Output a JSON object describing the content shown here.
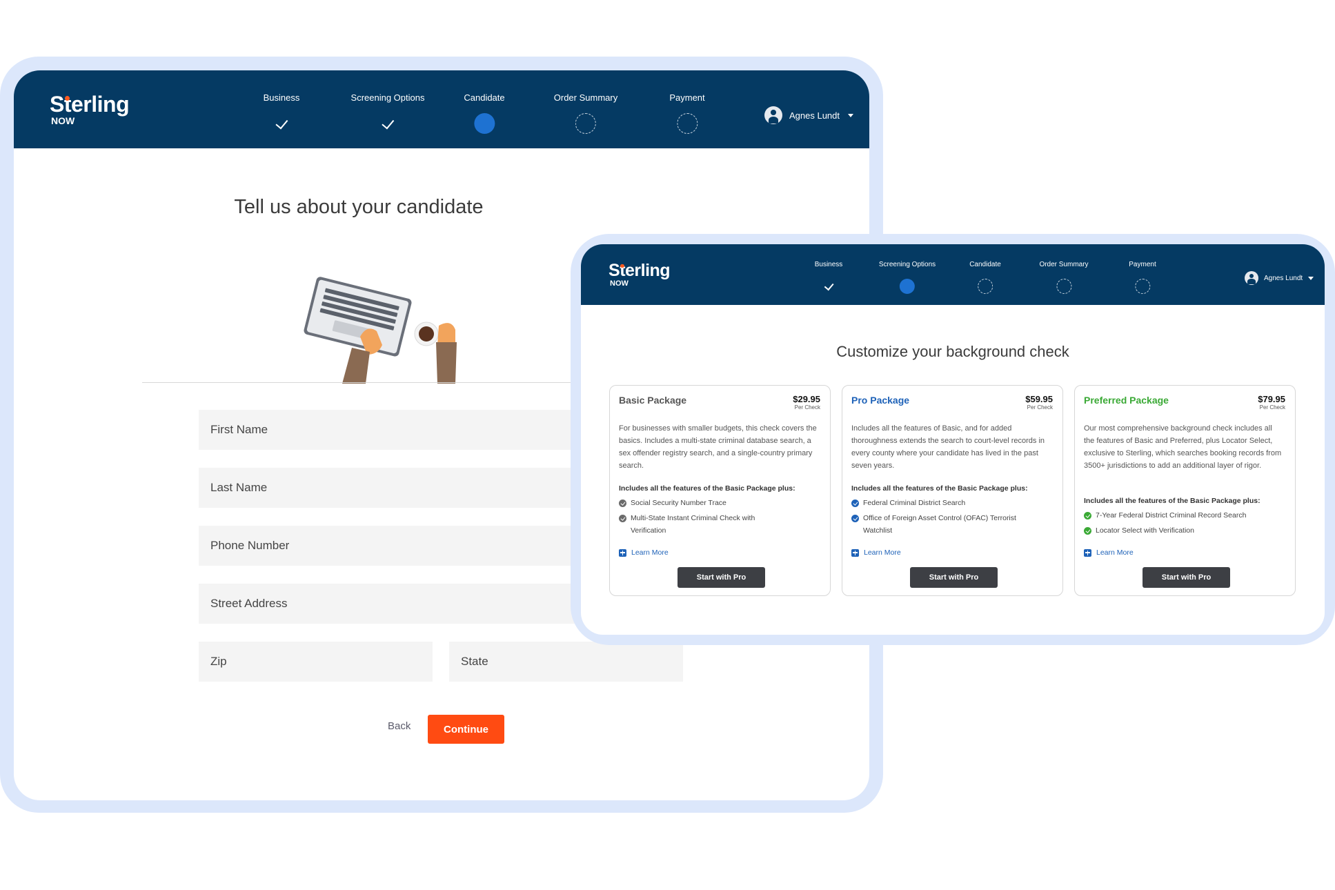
{
  "brand": {
    "word": "Sterling",
    "sub": "NOW",
    "accent": "#ff5a1f",
    "header_bg": "#053a63"
  },
  "window1": {
    "steps": [
      {
        "label": "Business",
        "state": "done"
      },
      {
        "label": "Screening Options",
        "state": "done"
      },
      {
        "label": "Candidate",
        "state": "active"
      },
      {
        "label": "Order Summary",
        "state": "todo"
      },
      {
        "label": "Payment",
        "state": "todo"
      }
    ],
    "user": {
      "name": "Agnes Lundt"
    },
    "title": "Tell us about your candidate",
    "fields": {
      "first_name": "First Name",
      "last_name": "Last Name",
      "phone": "Phone Number",
      "street": "Street Address",
      "zip": "Zip",
      "state": "State"
    },
    "back_label": "Back",
    "continue_label": "Continue",
    "continue_color": "#ff4b12"
  },
  "window2": {
    "steps": [
      {
        "label": "Business",
        "state": "done"
      },
      {
        "label": "Screening Options",
        "state": "active"
      },
      {
        "label": "Candidate",
        "state": "todo"
      },
      {
        "label": "Order Summary",
        "state": "todo"
      },
      {
        "label": "Payment",
        "state": "todo"
      }
    ],
    "user": {
      "name": "Agnes Lundt"
    },
    "title": "Customize your background check",
    "packages": [
      {
        "name": "Basic Package",
        "name_color": "#555555",
        "price": "$29.95",
        "per": "Per Check",
        "description": "For businesses with smaller budgets, this check covers the basics. Includes a multi-state criminal database search, a sex offender registry search, and a single-country primary search.",
        "includes_title": "Includes all the features of the Basic Package plus:",
        "check_color": "#6b6b6b",
        "features": [
          "Social Security Number Trace",
          "Multi-State Instant Criminal Check with Verification"
        ],
        "learn_more": "Learn More",
        "button": "Start with Pro"
      },
      {
        "name": "Pro Package",
        "name_color": "#1e62b8",
        "price": "$59.95",
        "per": "Per Check",
        "description": "Includes all the features of Basic, and for added thoroughness extends the search to court-level records in every county where your candidate has lived in the past seven years.",
        "includes_title": "Includes all the features of the Basic Package plus:",
        "check_color": "#1e62b8",
        "features": [
          "Federal Criminal District Search",
          "Office of Foreign Asset Control (OFAC) Terrorist Watchlist"
        ],
        "learn_more": "Learn More",
        "button": "Start with Pro"
      },
      {
        "name": "Preferred Package",
        "name_color": "#3aa935",
        "price": "$79.95",
        "per": "Per Check",
        "description": "Our most comprehensive background check includes all the features of Basic and Preferred, plus Locator Select, exclusive to Sterling, which searches booking records from 3500+ jurisdictions to add an additional layer of rigor.",
        "includes_title": "Includes all the features of the Basic Package plus:",
        "check_color": "#3aa935",
        "features": [
          "7-Year Federal District Criminal Record Search",
          "Locator Select with Verification"
        ],
        "learn_more": "Learn More",
        "button": "Start with Pro"
      }
    ]
  }
}
